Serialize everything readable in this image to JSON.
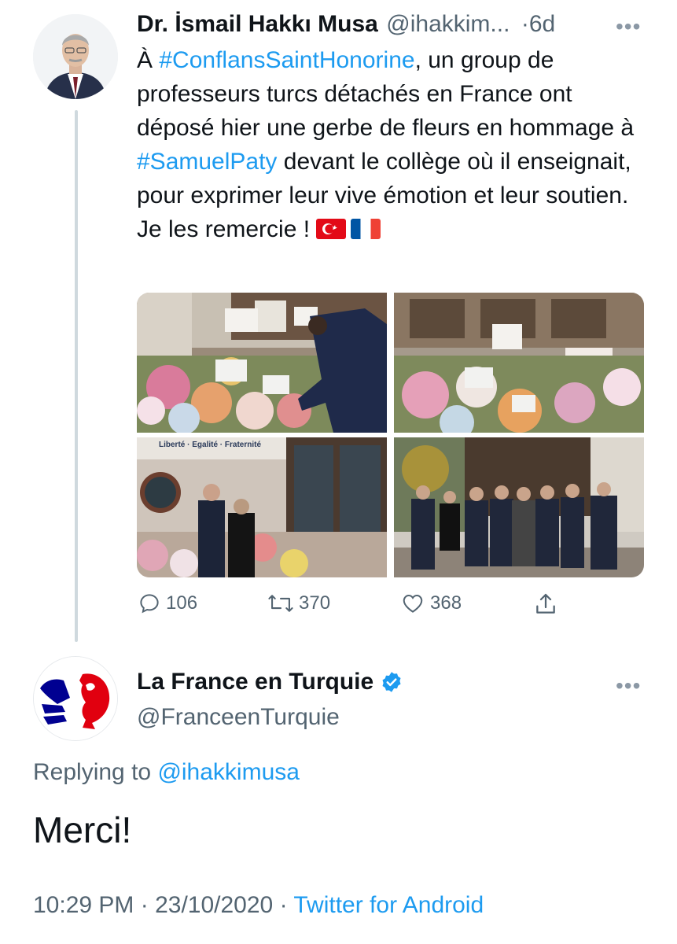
{
  "tweet1": {
    "name": "Dr. İsmail Hakkı Musa",
    "handle": "@ihakkim...",
    "separator": "·",
    "time": "6d",
    "more": "•••",
    "text_a": "À ",
    "hashtag_1": "#ConflansSaintHonorine",
    "text_b": ", un group de professeurs turcs détachés en France ont déposé hier une gerbe de fleurs en hommage à ",
    "hashtag_2": "#SamuelPaty",
    "text_c": " devant le collège où il enseignait, pour exprimer leur vive émotion et leur soutien. Je les remercie ! ",
    "flags": [
      "turkey-flag",
      "france-flag"
    ],
    "photo_sign_text": "Liberté · Egalité · Fraternité",
    "replies": "106",
    "retweets": "370",
    "likes": "368"
  },
  "tweet2": {
    "name": "La France en Turquie",
    "handle": "@FranceenTurquie",
    "more": "•••",
    "replying_label": "Replying to ",
    "replying_handle": "@ihakkimusa",
    "text": "Merci!",
    "time": "10:29 PM",
    "sep1": " · ",
    "date": "23/10/2020",
    "sep2": " · ",
    "source": "Twitter for Android"
  },
  "colors": {
    "link": "#1d9bf0",
    "text": "#0f1419",
    "secondary": "#536471",
    "verified": "#1d9bf0",
    "thread_line": "#cfd9de"
  }
}
